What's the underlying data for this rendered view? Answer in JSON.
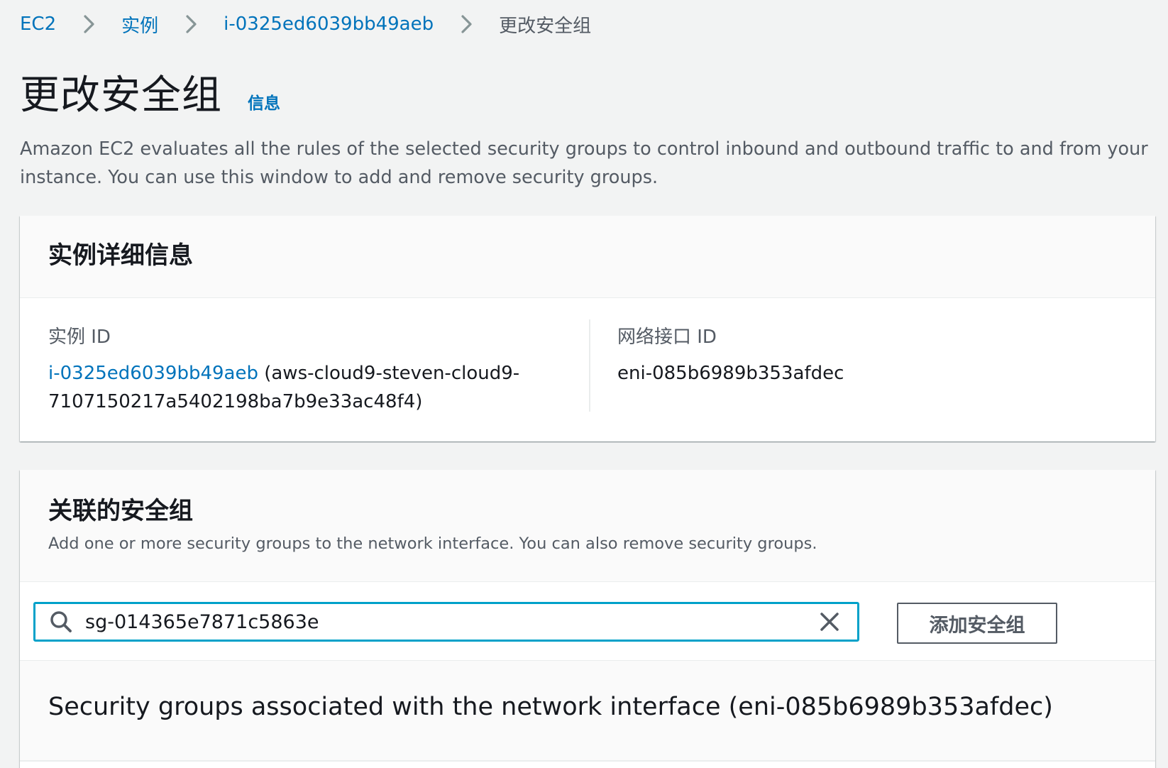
{
  "breadcrumb": {
    "items": [
      {
        "label": "EC2"
      },
      {
        "label": "实例"
      },
      {
        "label": "i-0325ed6039bb49aeb"
      },
      {
        "label": "更改安全组"
      }
    ]
  },
  "page": {
    "title": "更改安全组",
    "info_link": "信息",
    "description": "Amazon EC2 evaluates all the rules of the selected security groups to control inbound and outbound traffic to and from your instance. You can use this window to add and remove security groups."
  },
  "instance_details": {
    "header": "实例详细信息",
    "instance_id_label": "实例 ID",
    "instance_id_link": "i-0325ed6039bb49aeb",
    "instance_id_suffix": "(aws-cloud9-steven-cloud9-7107150217a5402198ba7b9e33ac48f4)",
    "eni_label": "网络接口 ID",
    "eni_value": "eni-085b6989b353afdec"
  },
  "associated_sg": {
    "header": "关联的安全组",
    "subtitle": "Add one or more security groups to the network interface. You can also remove security groups.",
    "search_value": "sg-014365e7871c5863e",
    "add_button": "添加安全组",
    "table_title": "Security groups associated with the network interface (eni-085b6989b353afdec)"
  },
  "colors": {
    "link": "#0073bb",
    "focus_border": "#00a1c9",
    "background": "#f2f3f3"
  },
  "icons": {
    "separator": "chevron-right-icon",
    "search": "search-icon",
    "clear": "close-icon"
  }
}
